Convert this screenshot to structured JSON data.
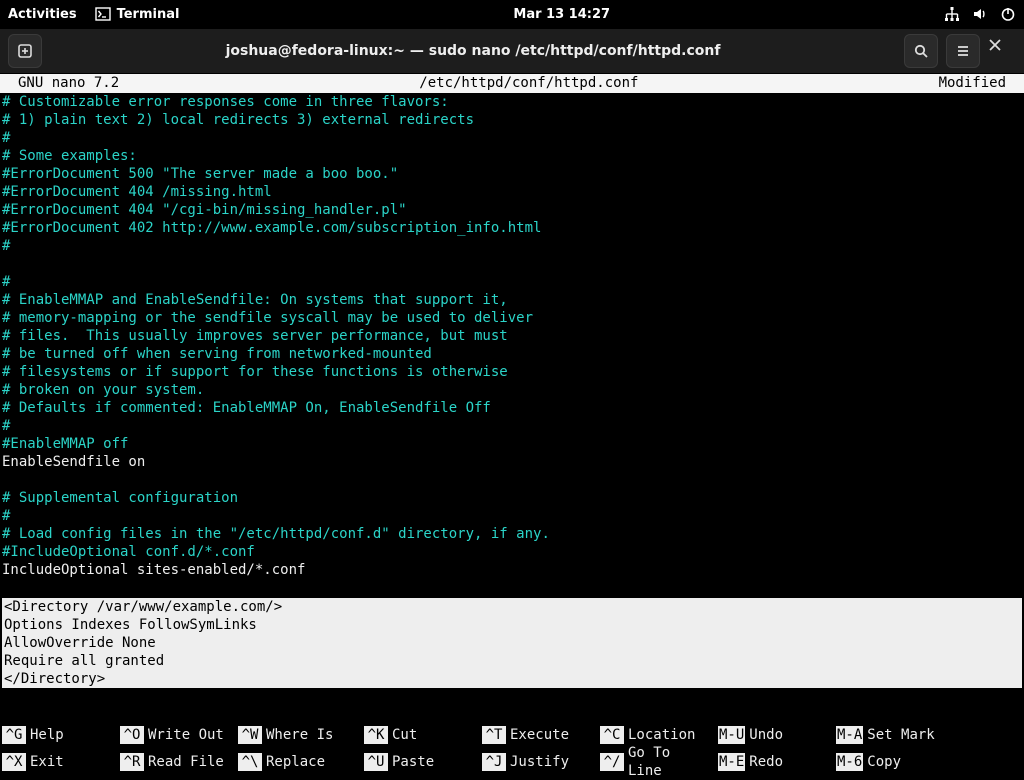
{
  "topbar": {
    "activities": "Activities",
    "app_name": "Terminal",
    "clock": "Mar 13  14:27"
  },
  "titlebar": {
    "title": "joshua@fedora-linux:~ — sudo nano /etc/httpd/conf/httpd.conf"
  },
  "nano": {
    "version": "  GNU nano 7.2",
    "filepath": "/etc/httpd/conf/httpd.conf",
    "status": "Modified  "
  },
  "lines": [
    {
      "cls": "c-comment",
      "text": "# Customizable error responses come in three flavors:"
    },
    {
      "cls": "c-comment",
      "text": "# 1) plain text 2) local redirects 3) external redirects"
    },
    {
      "cls": "c-comment",
      "text": "#"
    },
    {
      "cls": "c-comment",
      "text": "# Some examples:"
    },
    {
      "cls": "c-comment",
      "text": "#ErrorDocument 500 \"The server made a boo boo.\""
    },
    {
      "cls": "c-comment",
      "text": "#ErrorDocument 404 /missing.html"
    },
    {
      "cls": "c-comment",
      "text": "#ErrorDocument 404 \"/cgi-bin/missing_handler.pl\""
    },
    {
      "cls": "c-comment",
      "text": "#ErrorDocument 402 http://www.example.com/subscription_info.html"
    },
    {
      "cls": "c-comment",
      "text": "#"
    },
    {
      "cls": "c-comment",
      "text": ""
    },
    {
      "cls": "c-comment",
      "text": "#"
    },
    {
      "cls": "c-comment",
      "text": "# EnableMMAP and EnableSendfile: On systems that support it,"
    },
    {
      "cls": "c-comment",
      "text": "# memory-mapping or the sendfile syscall may be used to deliver"
    },
    {
      "cls": "c-comment",
      "text": "# files.  This usually improves server performance, but must"
    },
    {
      "cls": "c-comment",
      "text": "# be turned off when serving from networked-mounted"
    },
    {
      "cls": "c-comment",
      "text": "# filesystems or if support for these functions is otherwise"
    },
    {
      "cls": "c-comment",
      "text": "# broken on your system."
    },
    {
      "cls": "c-comment",
      "text": "# Defaults if commented: EnableMMAP On, EnableSendfile Off"
    },
    {
      "cls": "c-comment",
      "text": "#"
    },
    {
      "cls": "c-comment",
      "text": "#EnableMMAP off"
    },
    {
      "cls": "c-normal",
      "text": "EnableSendfile on"
    },
    {
      "cls": "c-comment",
      "text": ""
    },
    {
      "cls": "c-comment",
      "text": "# Supplemental configuration"
    },
    {
      "cls": "c-comment",
      "text": "#"
    },
    {
      "cls": "c-comment",
      "text": "# Load config files in the \"/etc/httpd/conf.d\" directory, if any."
    },
    {
      "cls": "c-comment",
      "text": "#IncludeOptional conf.d/*.conf"
    },
    {
      "cls": "c-normal",
      "text": "IncludeOptional sites-enabled/*.conf"
    },
    {
      "cls": "c-normal",
      "text": ""
    }
  ],
  "highlight_lines": [
    "<Directory /var/www/example.com/>",
    "Options Indexes FollowSymLinks",
    "AllowOverride None",
    "Require all granted",
    "</Directory>"
  ],
  "shortcuts": {
    "row1": [
      {
        "key": "^G",
        "label": "Help"
      },
      {
        "key": "^O",
        "label": "Write Out"
      },
      {
        "key": "^W",
        "label": "Where Is"
      },
      {
        "key": "^K",
        "label": "Cut"
      },
      {
        "key": "^T",
        "label": "Execute"
      },
      {
        "key": "^C",
        "label": "Location"
      },
      {
        "key": "M-U",
        "label": "Undo"
      },
      {
        "key": "M-A",
        "label": "Set Mark"
      }
    ],
    "row2": [
      {
        "key": "^X",
        "label": "Exit"
      },
      {
        "key": "^R",
        "label": "Read File"
      },
      {
        "key": "^\\",
        "label": "Replace"
      },
      {
        "key": "^U",
        "label": "Paste"
      },
      {
        "key": "^J",
        "label": "Justify"
      },
      {
        "key": "^/",
        "label": "Go To Line"
      },
      {
        "key": "M-E",
        "label": "Redo"
      },
      {
        "key": "M-6",
        "label": "Copy"
      }
    ]
  }
}
